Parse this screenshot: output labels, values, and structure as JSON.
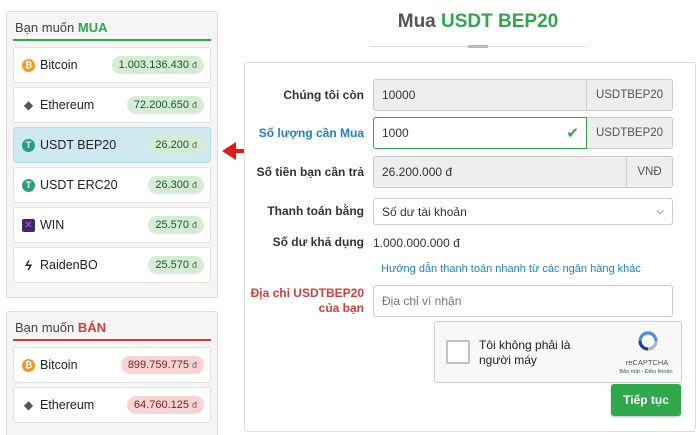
{
  "buy_panel": {
    "heading_prefix": "Bạn muốn",
    "heading_action": "MUA",
    "items": [
      {
        "name": "Bitcoin",
        "price": "1.003.136.430",
        "icon": "bitcoin-icon"
      },
      {
        "name": "Ethereum",
        "price": "72.200.650",
        "icon": "ethereum-icon"
      },
      {
        "name": "USDT BEP20",
        "price": "26.200",
        "icon": "tether-icon"
      },
      {
        "name": "USDT ERC20",
        "price": "26.300",
        "icon": "tether-icon"
      },
      {
        "name": "WIN",
        "price": "25.570",
        "icon": "win-icon"
      },
      {
        "name": "RaidenBO",
        "price": "25.570",
        "icon": "raiden-icon"
      }
    ]
  },
  "sell_panel": {
    "heading_prefix": "Bạn muốn",
    "heading_action": "BÁN",
    "items": [
      {
        "name": "Bitcoin",
        "price": "899.759.775",
        "icon": "bitcoin-icon"
      },
      {
        "name": "Ethereum",
        "price": "64.760.125",
        "icon": "ethereum-icon"
      }
    ]
  },
  "currency_symbol": "đ",
  "title": {
    "prefix": "Mua",
    "asset": "USDT BEP20"
  },
  "form": {
    "remaining_label": "Chúng tôi còn",
    "remaining_value": "10000",
    "remaining_unit": "USDTBEP20",
    "amount_label": "Số lượng cần Mua",
    "amount_value": "1000",
    "amount_unit": "USDTBEP20",
    "pay_label": "Số tiền bạn cần trả",
    "pay_value": "26.200.000 đ",
    "pay_unit": "VNĐ",
    "method_label": "Thanh toán bằng",
    "method_value": "Số dư tài khoản",
    "balance_label": "Số dư khả dụng",
    "balance_value": "1.000.000.000 đ",
    "guide_link": "Hướng dẫn thanh toán nhanh từ các ngân hàng khác",
    "address_label_line1": "Địa chỉ USDTBEP20",
    "address_label_line2": "của bạn",
    "address_placeholder": "Địa chỉ ví nhận",
    "captcha_text": "Tôi không phải là người máy",
    "captcha_brand": "reCAPTCHA",
    "captcha_links": "Bảo mật - Điều khoản",
    "submit_label": "Tiếp tục"
  },
  "colors": {
    "accent_green": "#2ea84a",
    "sell_red": "#d93a3a",
    "link_blue": "#1d7fd1",
    "active_row": "#cfe9f0",
    "arrow_red": "#e01b1b"
  }
}
